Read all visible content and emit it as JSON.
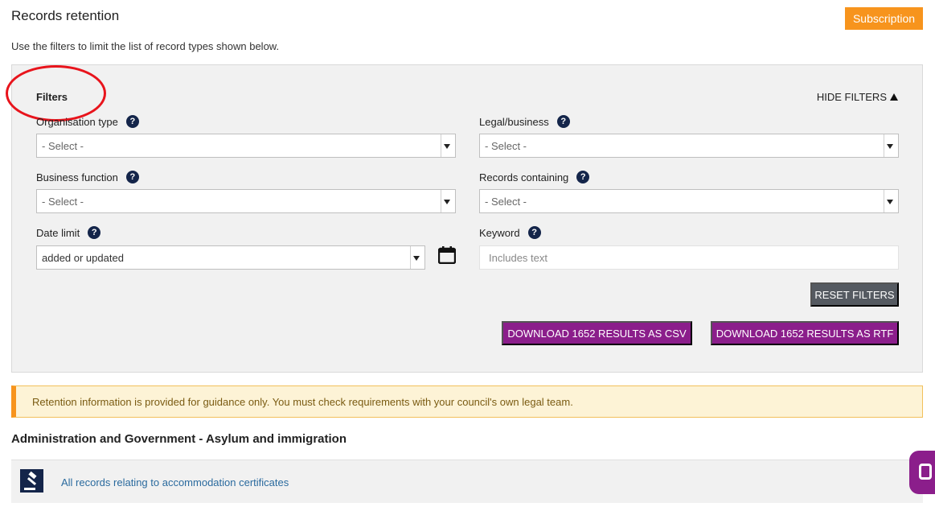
{
  "header": {
    "title": "Records retention",
    "subscription_label": "Subscription",
    "intro": "Use the filters to limit the list of record types shown below."
  },
  "filters": {
    "heading": "Filters",
    "hide_label": "HIDE FILTERS",
    "fields": {
      "organisation_type": {
        "label": "Organisation type",
        "value": "- Select -"
      },
      "legal_business": {
        "label": "Legal/business",
        "value": "- Select -"
      },
      "business_function": {
        "label": "Business function",
        "value": "- Select -"
      },
      "records_containing": {
        "label": "Records containing",
        "value": "- Select -"
      },
      "date_limit": {
        "label": "Date limit",
        "value": "added or updated"
      },
      "keyword": {
        "label": "Keyword",
        "placeholder": "Includes text"
      }
    },
    "help_glyph": "?",
    "reset_label": "RESET FILTERS",
    "download_csv_label": "DOWNLOAD 1652 RESULTS AS CSV",
    "download_rtf_label": "DOWNLOAD 1652 RESULTS AS RTF"
  },
  "notice": {
    "text": "Retention information is provided for guidance only. You must check requirements with your council's own legal team."
  },
  "results": {
    "section_title": "Administration and Government - Asylum and immigration",
    "rows": [
      {
        "label": "All records relating to accommodation certificates",
        "icon": "gavel-icon"
      }
    ]
  },
  "colors": {
    "accent_orange": "#f7941d",
    "download_purple": "#8b1e8b",
    "help_navy": "#14254a",
    "annotation_red": "#e8141c"
  }
}
